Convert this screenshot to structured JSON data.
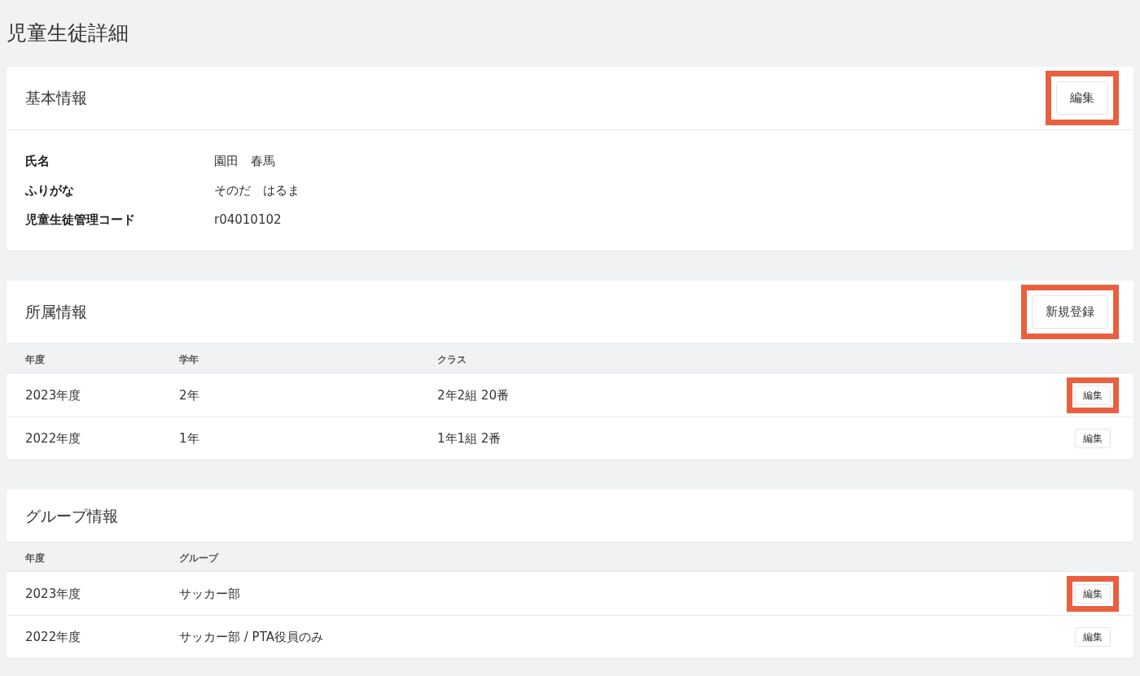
{
  "page_title": "児童生徒詳細",
  "basic_info": {
    "title": "基本情報",
    "button": {
      "label": "編集",
      "highlighted": true
    },
    "fields": [
      {
        "label": "氏名",
        "value": "園田　春馬"
      },
      {
        "label": "ふりがな",
        "value": "そのだ　はるま"
      },
      {
        "label": "児童生徒管理コード",
        "value": "r04010102"
      }
    ]
  },
  "affiliation": {
    "title": "所属情報",
    "button": {
      "label": "新規登録",
      "highlighted": true
    },
    "columns": [
      "年度",
      "学年",
      "クラス"
    ],
    "rows": [
      {
        "cells": [
          "2023年度",
          "2年",
          "2年2組 20番"
        ],
        "button": {
          "label": "編集",
          "highlighted": true
        }
      },
      {
        "cells": [
          "2022年度",
          "1年",
          "1年1組 2番"
        ],
        "button": {
          "label": "編集",
          "highlighted": false
        }
      }
    ]
  },
  "groups": {
    "title": "グループ情報",
    "columns": [
      "年度",
      "グループ"
    ],
    "rows": [
      {
        "cells": [
          "2023年度",
          "サッカー部"
        ],
        "button": {
          "label": "編集",
          "highlighted": true
        }
      },
      {
        "cells": [
          "2022年度",
          "サッカー部 / PTA役員のみ"
        ],
        "button": {
          "label": "編集",
          "highlighted": false
        }
      }
    ]
  }
}
